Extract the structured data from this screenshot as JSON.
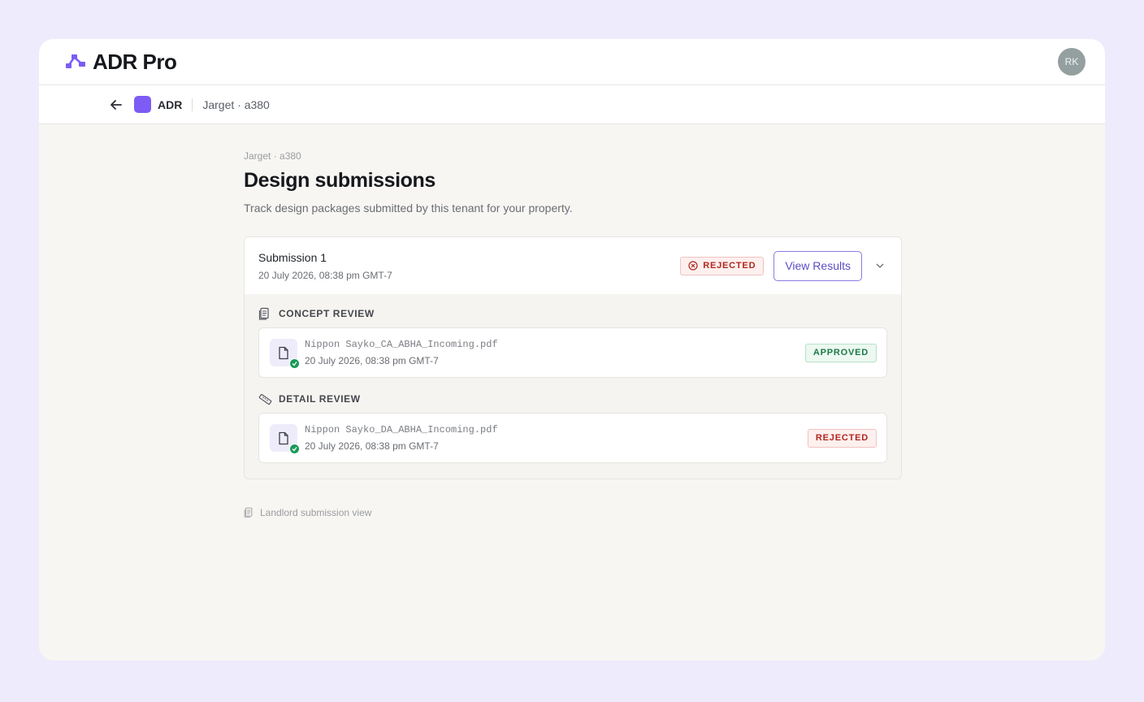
{
  "app": {
    "name": "ADR Pro",
    "user_initials": "RK"
  },
  "subnav": {
    "app_label": "ADR",
    "breadcrumb": "Jarget · a380"
  },
  "page": {
    "breadcrumb": "Jarget · a380",
    "title": "Design submissions",
    "description": "Track design packages submitted by this tenant for your property."
  },
  "submission": {
    "title": "Submission 1",
    "date": "20 July 2026, 08:38 pm GMT-7",
    "status": "REJECTED",
    "view_results_label": "View Results",
    "sections": [
      {
        "label": "CONCEPT REVIEW",
        "icon": "document-stack-icon",
        "file": {
          "name": "Nippon Sayko_CA_ABHA_Incoming.pdf",
          "date": "20 July 2026, 08:38 pm GMT-7",
          "status": "APPROVED"
        }
      },
      {
        "label": "DETAIL REVIEW",
        "icon": "ruler-icon",
        "file": {
          "name": "Nippon Sayko_DA_ABHA_Incoming.pdf",
          "date": "20 July 2026, 08:38 pm GMT-7",
          "status": "REJECTED"
        }
      }
    ]
  },
  "footer": {
    "note": "Landlord submission view"
  },
  "colors": {
    "accent": "#7c5cf5",
    "rejected": "#b3261e",
    "approved": "#1b7a46",
    "page_bg": "#eeebfd"
  }
}
